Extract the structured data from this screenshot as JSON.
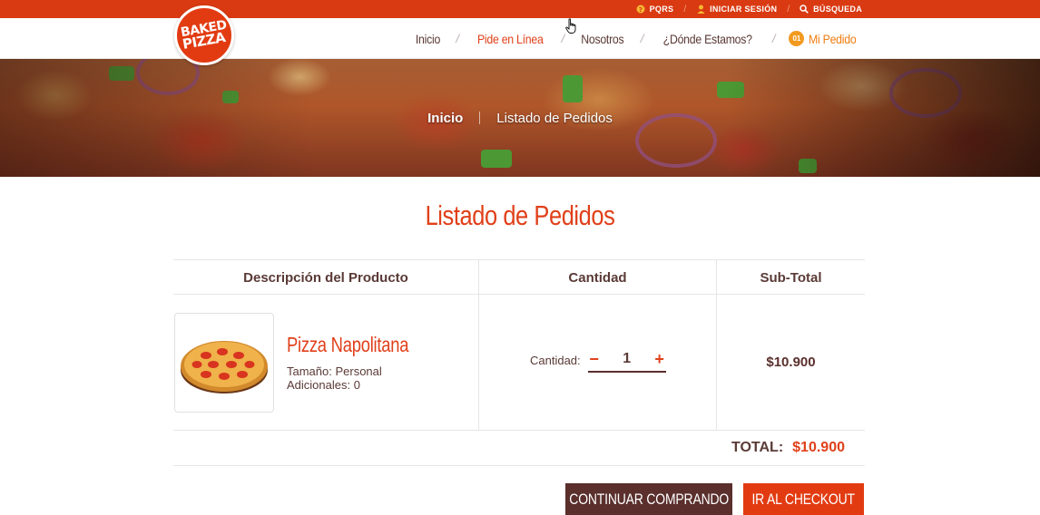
{
  "topbar": {
    "links": [
      {
        "label": "PQRS",
        "icon": "question-circle-icon"
      },
      {
        "label": "INICIAR SESIÓN",
        "icon": "user-icon"
      },
      {
        "label": "BÚSQUEDA",
        "icon": "search-icon"
      }
    ],
    "separator": "/"
  },
  "logo": {
    "line1": "BAKED",
    "line2": "PIZZA"
  },
  "nav": {
    "items": [
      {
        "label": "Inicio",
        "active": false
      },
      {
        "label": "Pide en Línea",
        "active": true
      },
      {
        "label": "Nosotros",
        "active": false
      },
      {
        "label": "¿Dónde Estamos?",
        "active": false
      }
    ],
    "separator": "/",
    "order": {
      "badge": "01",
      "label": "Mi Pedido"
    }
  },
  "hero": {
    "breadcrumb": {
      "home": "Inicio",
      "current": "Listado de Pedidos"
    }
  },
  "page": {
    "title": "Listado de Pedidos"
  },
  "table": {
    "headers": [
      "Descripción del Producto",
      "Cantidad",
      "Sub-Total"
    ],
    "rows": [
      {
        "name": "Pizza Napolitana",
        "size": "Tamaño: Personal",
        "extras": "Adicionales: 0",
        "quantity_label": "Cantidad:",
        "quantity": "1",
        "minus": "−",
        "plus": "+",
        "subtotal": "$10.900"
      }
    ],
    "total_label": "TOTAL:",
    "total_value": "$10.900"
  },
  "actions": {
    "continue_label": "CONTINUAR COMPRANDO",
    "checkout_label": "IR AL CHECKOUT"
  },
  "colors": {
    "brand_red": "#e23b12",
    "accent_orange": "#f07e12",
    "dark_brown": "#5a2f2c"
  }
}
